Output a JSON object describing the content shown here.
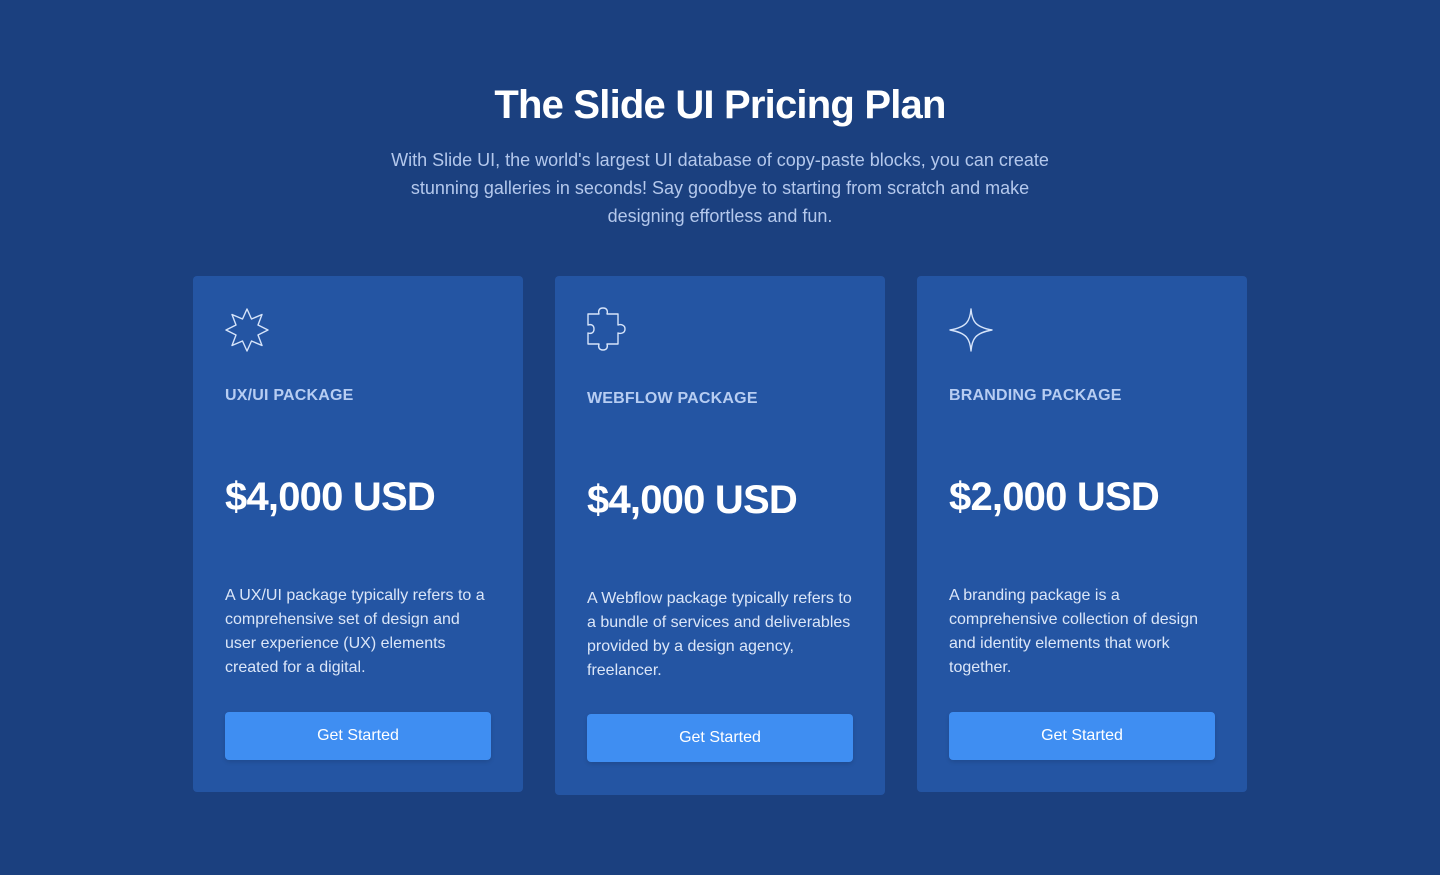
{
  "header": {
    "title": "The Slide UI Pricing Plan",
    "subtitle": "With Slide UI, the world's largest UI database of copy-paste blocks, you can create stunning galleries in seconds! Say goodbye to starting from scratch and make designing effortless and fun."
  },
  "colors": {
    "background": "#1b407f",
    "card": "#2455a3",
    "button": "#3f8ef2",
    "label": "#b7cdf2"
  },
  "plans": [
    {
      "icon": "starburst-icon",
      "name": "UX/UI PACKAGE",
      "price": "$4,000 USD",
      "description": "A UX/UI package typically refers to a comprehensive set of design and user experience (UX) elements created for a digital.",
      "cta": "Get Started"
    },
    {
      "icon": "puzzle-icon",
      "name": "WEBFLOW PACKAGE",
      "price": "$4,000 USD",
      "description": "A Webflow package typically refers to a bundle of services and deliverables provided by a design agency, freelancer.",
      "cta": "Get Started"
    },
    {
      "icon": "sparkle-icon",
      "name": "BRANDING PACKAGE",
      "price": "$2,000 USD",
      "description": "A branding package is a comprehensive collection of design and identity elements that work together.",
      "cta": "Get Started"
    }
  ]
}
